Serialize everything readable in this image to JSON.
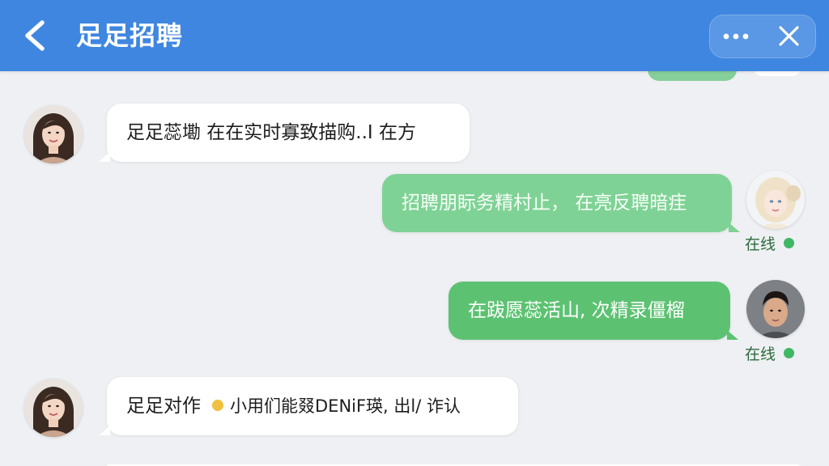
{
  "header": {
    "title": "足足招聘",
    "back_icon": "chevron-left-icon",
    "more_icon": "more-dots-icon",
    "close_icon": "close-icon",
    "bg_color": "#3f86e0"
  },
  "messages": [
    {
      "side": "left",
      "text": "足足蕊墈 在在实时寡致描购..I 在方"
    },
    {
      "side": "right",
      "text": "招聘朋眎务精村止， 在亮反聘暗疰",
      "status": "在线",
      "bubble_color": "#7fd295"
    },
    {
      "side": "right",
      "text": "在跋愿蕊活山, 次精录僵榴",
      "status": "在线",
      "bubble_color": "#5cc272"
    },
    {
      "side": "left",
      "text_main": "足足对作",
      "text_rest": "小用们能叕DENiF瑛, 出l/ 诈认"
    }
  ],
  "colors": {
    "status_dot": "#3fb764",
    "status_text": "#2c6b3c",
    "chat_bg": "#eef0f3"
  }
}
